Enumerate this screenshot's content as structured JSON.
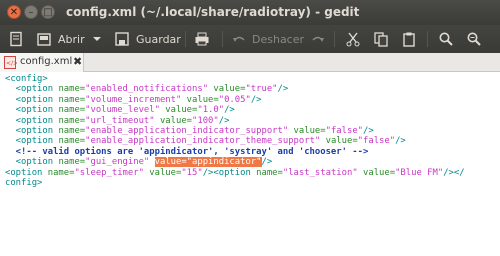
{
  "window": {
    "title": "config.xml (~/.local/share/radiotray) - gedit"
  },
  "toolbar": {
    "open_label": "Abrir",
    "save_label": "Guardar",
    "undo_label": "Deshacer"
  },
  "tabs": [
    {
      "label": "config.xml",
      "close_glyph": "✖"
    }
  ],
  "editor": {
    "lines": [
      [
        "<config>"
      ],
      [
        "  <option ",
        "name=",
        "\"enabled_notifications\"",
        " value=",
        "\"true\"",
        "/>"
      ],
      [
        "  <option ",
        "name=",
        "\"volume_increment\"",
        " value=",
        "\"0.05\"",
        "/>"
      ],
      [
        "  <option ",
        "name=",
        "\"volume_level\"",
        " value=",
        "\"1.0\"",
        "/>"
      ],
      [
        "  <option ",
        "name=",
        "\"url_timeout\"",
        " value=",
        "\"100\"",
        "/>"
      ],
      [
        "  <option ",
        "name=",
        "\"enable_application_indicator_support\"",
        " value=",
        "\"false\"",
        "/>"
      ],
      [
        "  <option ",
        "name=",
        "\"enable_application_indicator_theme_support\"",
        " value=",
        "\"false\"",
        "/>"
      ],
      [
        "  <!-- valid options are 'appindicator', 'systray' and 'chooser' -->"
      ],
      [
        "  <option ",
        "name=",
        "\"gui_engine\"",
        " ",
        "value=\"appindicator\"",
        "/>"
      ],
      [
        "<option ",
        "name=",
        "\"sleep_timer\"",
        " value=",
        "\"15\"",
        "/>",
        "<option ",
        "name=",
        "\"last_station\"",
        " value=",
        "\"Blue FM\"",
        "/></"
      ],
      [
        "config>"
      ]
    ]
  }
}
